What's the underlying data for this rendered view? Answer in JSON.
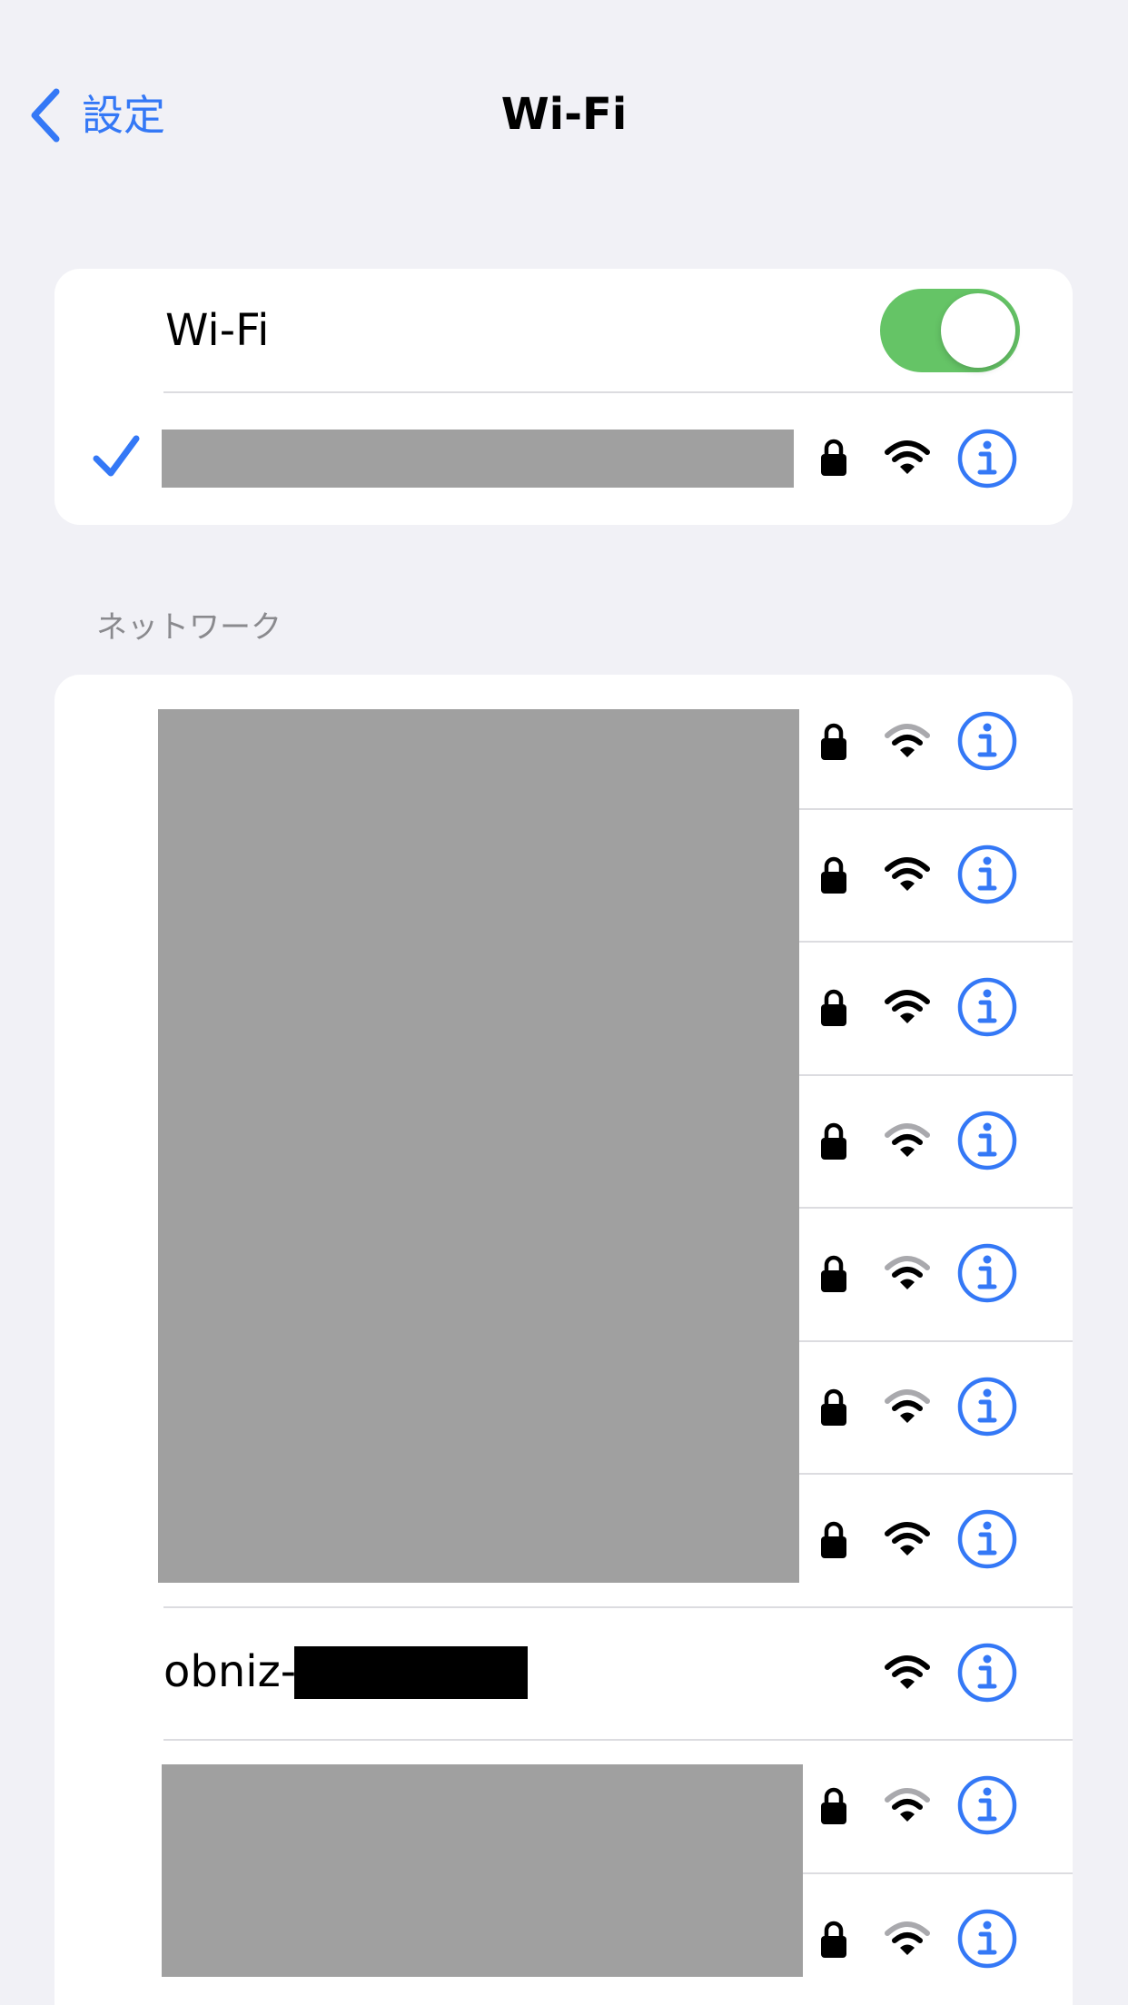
{
  "navbar": {
    "back_label": "設定",
    "title": "Wi-Fi"
  },
  "wifi_toggle": {
    "label": "Wi-Fi",
    "on": true
  },
  "connected_network": {
    "name_redacted": true,
    "secured": true,
    "signal": "full"
  },
  "networks_section": {
    "header": "ネットワーク",
    "items": [
      {
        "name_redacted": true,
        "secured": true,
        "signal": "weak"
      },
      {
        "name_redacted": true,
        "secured": true,
        "signal": "full"
      },
      {
        "name_redacted": true,
        "secured": true,
        "signal": "full"
      },
      {
        "name_redacted": true,
        "secured": true,
        "signal": "weak"
      },
      {
        "name_redacted": true,
        "secured": true,
        "signal": "weak"
      },
      {
        "name_redacted": true,
        "secured": true,
        "signal": "weak"
      },
      {
        "name_redacted": true,
        "secured": true,
        "signal": "full"
      },
      {
        "name_prefix": "obniz-",
        "name_partially_redacted": true,
        "secured": false,
        "signal": "full"
      },
      {
        "name_redacted": true,
        "secured": true,
        "signal": "weak"
      },
      {
        "name_redacted": true,
        "secured": true,
        "signal": "weak"
      }
    ]
  },
  "colors": {
    "accent": "#3478f6",
    "toggle_on": "#65c466",
    "background": "#f1f1f6",
    "signal_dim": "#a9a9ad",
    "redaction": "#a0a0a0"
  },
  "icons": {
    "back": "chevron-left-icon",
    "connected": "checkmark-icon",
    "secured": "lock-icon",
    "signal": "wifi-icon",
    "details": "info-icon"
  }
}
